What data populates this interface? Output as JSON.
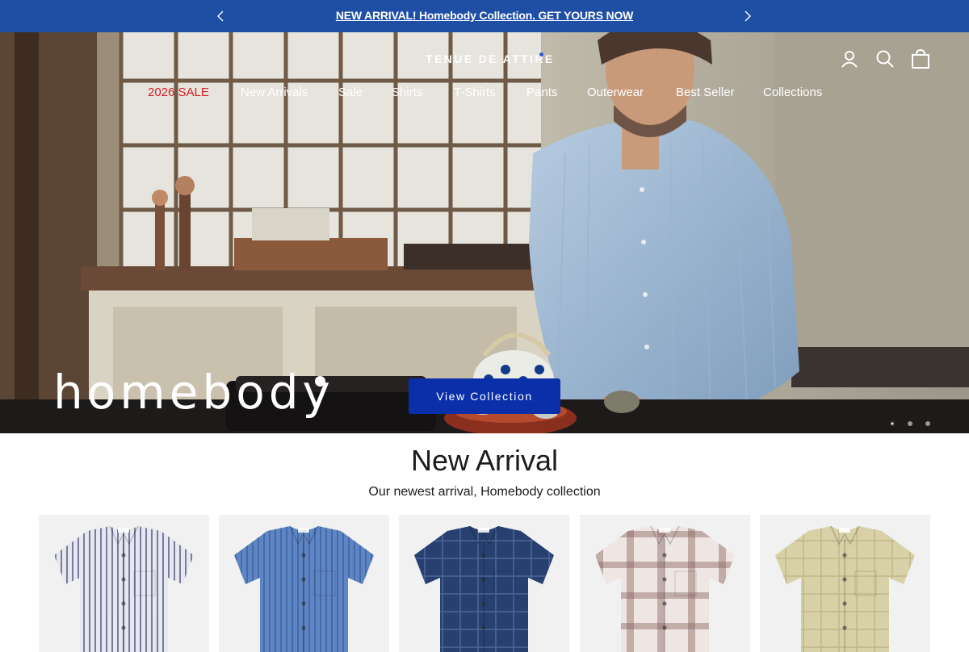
{
  "announcement": {
    "text": "NEW ARRIVAL! Homebody Collection. GET YOURS NOW",
    "background": "#1f4fa5"
  },
  "header": {
    "logo": "TENUE DE ATTIRE",
    "icons": [
      "account-icon",
      "search-icon",
      "bag-icon"
    ]
  },
  "nav": {
    "items": [
      {
        "label": "2026 SALE",
        "highlight": true
      },
      {
        "label": "New Arrivals"
      },
      {
        "label": "Sale"
      },
      {
        "label": "Shirts"
      },
      {
        "label": "T-Shirts"
      },
      {
        "label": "Pants"
      },
      {
        "label": "Outerwear"
      },
      {
        "label": "Best Seller"
      },
      {
        "label": "Collections"
      }
    ],
    "highlight_color": "#d81f26"
  },
  "hero": {
    "heading": "homebody",
    "cta_label": "View Collection",
    "cta_color": "#0a2fa8",
    "slides_total": 3,
    "active_slide": 1
  },
  "new_arrival": {
    "title": "New Arrival",
    "subtitle": "Our newest arrival, Homebody collection",
    "products": [
      {
        "name": "white-navy-striped-shirt",
        "color": "#e7e8ef",
        "pattern": "stripe",
        "pattern_color": "#4a4f78"
      },
      {
        "name": "blue-striped-shirt",
        "color": "#5f86c4",
        "pattern": "stripe",
        "pattern_color": "#3e5f9a"
      },
      {
        "name": "navy-check-shirt",
        "color": "#27406f",
        "pattern": "check",
        "pattern_color": "#4a6596"
      },
      {
        "name": "brown-plaid-shirt",
        "color": "#efe6e3",
        "pattern": "plaid",
        "pattern_color": "#8a6660"
      },
      {
        "name": "beige-check-shirt",
        "color": "#d8d1a8",
        "pattern": "check",
        "pattern_color": "#c2b98a"
      }
    ]
  }
}
